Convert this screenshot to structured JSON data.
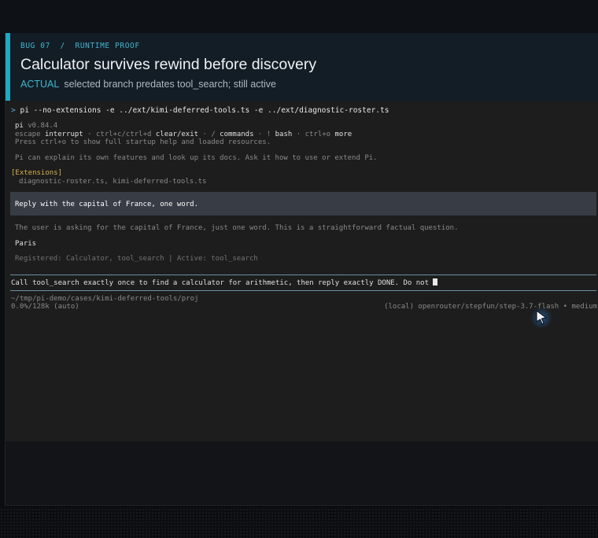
{
  "header": {
    "kicker": "BUG 07  /  RUNTIME PROOF",
    "title": "Calculator survives rewind before discovery",
    "subtitle_tag": "ACTUAL",
    "subtitle": "selected branch predates tool_search; still active",
    "accent_color": "#21a7c4"
  },
  "terminal": {
    "prompt_symbol": ">",
    "command": "pi --no-extensions -e ../ext/kimi-deferred-tools.ts -e ../ext/diagnostic-roster.ts",
    "app_name": "pi",
    "version": "v0.84.4",
    "keys": {
      "escape": "escape",
      "interrupt": "interrupt",
      "ctrl_c": "ctrl+c/ctrl+d",
      "clear_exit": "clear/exit",
      "slash": "/",
      "commands": "commands",
      "bang": "!",
      "bash": "bash",
      "ctrl_o": "ctrl+o",
      "more": "more"
    },
    "startup_hint": "Press ctrl+o to show full startup help and loaded resources.",
    "intro": "Pi can explain its own features and look up its docs. Ask it how to use or extend Pi.",
    "extensions_header": "[Extensions]",
    "extensions_list": "diagnostic-roster.ts, kimi-deferred-tools.ts",
    "user_message": "Reply with the capital of France, one word.",
    "thinking": "The user is asking for the capital of France, just one word. This is a straightforward factual question.",
    "answer": "Paris",
    "registered_line": "Registered: Calculator, tool_search | Active: tool_search",
    "input_text": "Call tool_search exactly once to find a calculator for arithmetic, then reply exactly DONE. Do not ",
    "cwd": "~/tmp/pi-demo/cases/kimi-deferred-tools/proj",
    "context_usage": "0.0%/128k (auto)",
    "model": "(local) openrouter/stepfun/step-3.7-flash • medium"
  }
}
